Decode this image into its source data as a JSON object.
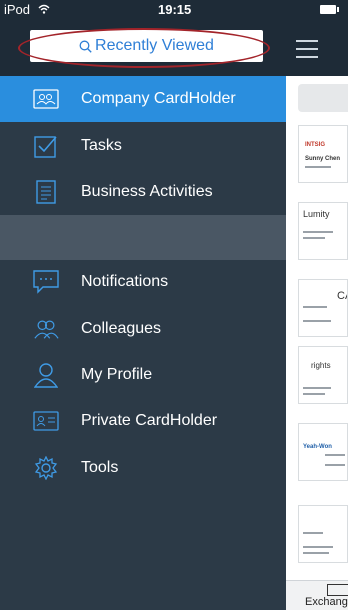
{
  "status_bar": {
    "carrier": "iPod",
    "time": "19:15"
  },
  "search": {
    "label": "Recently Viewed"
  },
  "menu": {
    "primary": [
      {
        "label": "Company CardHolder",
        "icon": "company-cardholder-icon",
        "active": true
      },
      {
        "label": "Tasks",
        "icon": "tasks-icon"
      },
      {
        "label": "Business Activities",
        "icon": "business-activities-icon"
      }
    ],
    "secondary": [
      {
        "label": "Notifications",
        "icon": "notifications-icon"
      },
      {
        "label": "Colleagues",
        "icon": "colleagues-icon"
      },
      {
        "label": "My Profile",
        "icon": "profile-icon"
      },
      {
        "label": "Private CardHolder",
        "icon": "private-cardholder-icon"
      },
      {
        "label": "Tools",
        "icon": "tools-icon"
      }
    ]
  },
  "peek": {
    "cards": [
      {
        "brand": "INTSIG",
        "name": "Sunny Chen"
      },
      {
        "brand": "Lumity"
      },
      {
        "brand": "CA"
      },
      {
        "brand": "rights"
      },
      {
        "brand": "Yeah-Won"
      },
      {
        "brand": ""
      }
    ],
    "bottom_label": "Exchang"
  },
  "colors": {
    "accent": "#2a8ede",
    "drawer": "#2c3a47",
    "highlight_ellipse": "#a3242a"
  }
}
